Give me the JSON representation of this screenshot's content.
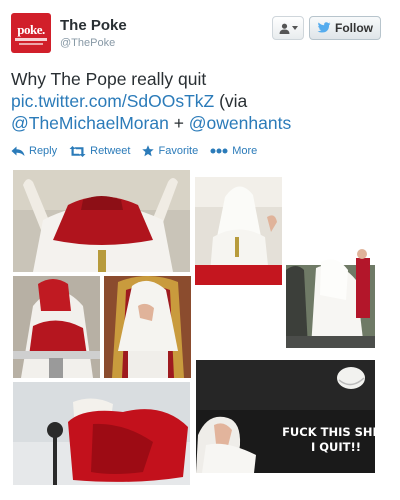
{
  "header": {
    "avatar_text": "poke.",
    "display_name": "The Poke",
    "handle": "@ThePoke",
    "follow_label": "Follow"
  },
  "tweet": {
    "line1": "Why The Pope really quit",
    "link": "pic.twitter.com/SdOOsTkZ",
    "via": " (via",
    "mention1": "@TheMichaelMoran",
    "plus": " + ",
    "mention2": "@owenhants"
  },
  "actions": {
    "reply": "Reply",
    "retweet": "Retweet",
    "favorite": "Favorite",
    "more": "More"
  },
  "image": {
    "caption_line1": "FUCK THIS SHIT!",
    "caption_line2": "I QUIT!!"
  },
  "colors": {
    "link": "#2b7bb9",
    "brand_red": "#d11f2a",
    "twitter_blue": "#55acee"
  },
  "icons": [
    "user-icon",
    "twitter-bird-icon",
    "reply-icon",
    "retweet-icon",
    "star-icon",
    "more-dots-icon"
  ]
}
